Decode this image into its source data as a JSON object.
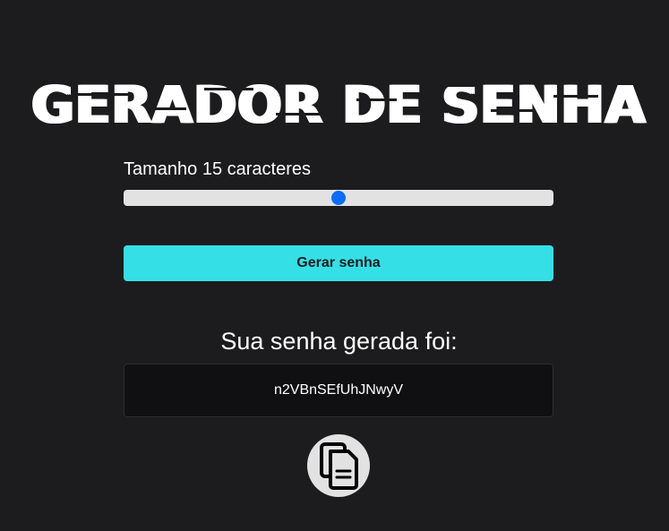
{
  "header": {
    "title": "GERADOR DE SENHA"
  },
  "length": {
    "label": "Tamanho 15 caracteres",
    "value": 15,
    "slider_fraction": 0.5
  },
  "generate": {
    "label": "Gerar senha"
  },
  "result": {
    "title": "Sua senha gerada foi:",
    "password": "n2VBnSEfUhJNwyV"
  },
  "copy": {
    "icon": "copy-icon"
  },
  "colors": {
    "background": "#1c1c1e",
    "button": "#34e0e6",
    "slider_thumb": "#0b6cff",
    "password_box": "#101012"
  }
}
